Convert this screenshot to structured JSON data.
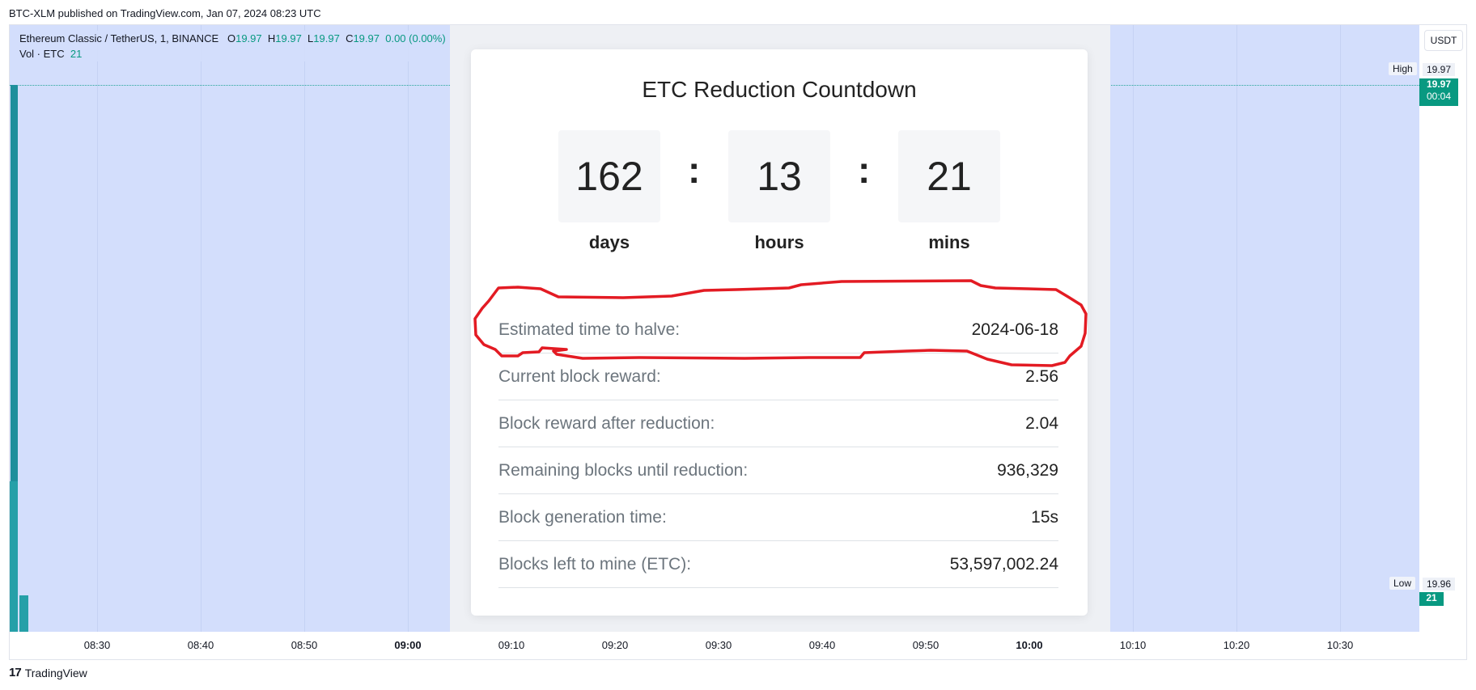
{
  "header": {
    "published_line": "BTC-XLM published on TradingView.com, Jan 07, 2024 08:23 UTC"
  },
  "legend": {
    "symbol": "Ethereum Classic / TetherUS, 1, BINANCE",
    "o_label": "O",
    "o_value": "19.97",
    "h_label": "H",
    "h_value": "19.97",
    "l_label": "L",
    "l_value": "19.97",
    "c_label": "C",
    "c_value": "19.97",
    "change": "0.00 (0.00%)",
    "vol_label": "Vol · ETC",
    "vol_value": "21"
  },
  "price_axis": {
    "currency_button": "USDT",
    "high_label": "High",
    "high_value": "19.97",
    "last_price": "19.97",
    "countdown": "00:04",
    "low_label": "Low",
    "low_value": "19.96",
    "volume_tag": "21"
  },
  "time_axis": {
    "ticks": [
      {
        "label": "08:30",
        "bold": false
      },
      {
        "label": "08:40",
        "bold": false
      },
      {
        "label": "08:50",
        "bold": false
      },
      {
        "label": "09:00",
        "bold": true
      },
      {
        "label": "09:10",
        "bold": false
      },
      {
        "label": "09:20",
        "bold": false
      },
      {
        "label": "09:30",
        "bold": false
      },
      {
        "label": "09:40",
        "bold": false
      },
      {
        "label": "09:50",
        "bold": false
      },
      {
        "label": "10:00",
        "bold": true
      },
      {
        "label": "10:10",
        "bold": false
      },
      {
        "label": "10:20",
        "bold": false
      },
      {
        "label": "10:30",
        "bold": false
      }
    ]
  },
  "footer": {
    "brand": "TradingView"
  },
  "card": {
    "title": "ETC Reduction Countdown",
    "countdown": {
      "days": "162",
      "hours": "13",
      "mins": "21",
      "days_label": "days",
      "hours_label": "hours",
      "mins_label": "mins",
      "separator": ":"
    },
    "rows": [
      {
        "key": "Estimated time to halve:",
        "value": "2024-06-18"
      },
      {
        "key": "Current block reward:",
        "value": "2.56"
      },
      {
        "key": "Block reward after reduction:",
        "value": "2.04"
      },
      {
        "key": "Remaining blocks until reduction:",
        "value": "936,329"
      },
      {
        "key": "Block generation time:",
        "value": "15s"
      },
      {
        "key": "Blocks left to mine (ETC):",
        "value": "53,597,002.24"
      }
    ]
  },
  "colors": {
    "plot_bg": "#d3defc",
    "accent_green": "#089981",
    "annotation_red": "#e31b23"
  }
}
